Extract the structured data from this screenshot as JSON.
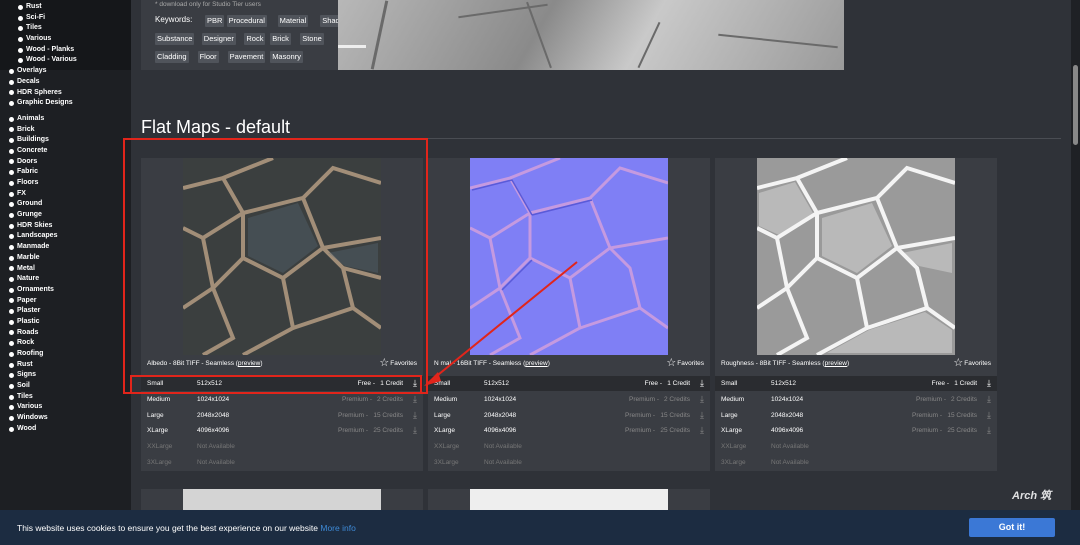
{
  "sidebar": {
    "sub_items": [
      "Rust",
      "Sci-Fi",
      "Tiles",
      "Various",
      "Wood - Planks",
      "Wood - Various"
    ],
    "group1": [
      "Overlays",
      "Decals",
      "HDR Spheres",
      "Graphic Designs"
    ],
    "group2": [
      "Animals",
      "Brick",
      "Buildings",
      "Concrete",
      "Doors",
      "Fabric",
      "Floors",
      "FX",
      "Ground",
      "Grunge",
      "HDR Skies",
      "Landscapes",
      "Manmade",
      "Marble",
      "Metal",
      "Nature",
      "Ornaments",
      "Paper",
      "Plaster",
      "Plastic",
      "Roads",
      "Rock",
      "Roofing",
      "Rust",
      "Signs",
      "Soil",
      "Tiles",
      "Various",
      "Windows",
      "Wood"
    ]
  },
  "info": {
    "note": "* download only for Studio Tier users",
    "keywords_label": "Keywords:",
    "tags": [
      "PBR",
      "Procedural",
      "Material",
      "Shader",
      "Substance",
      "Designer",
      "Rock",
      "Brick",
      "Stone",
      "Cladding",
      "Floor",
      "Pavement",
      "Masonry"
    ]
  },
  "section": {
    "title": "Flat Maps - default"
  },
  "cards": [
    {
      "format": "Albedo - 8Bit TIFF - Seamless",
      "preview": "preview",
      "favorites": "Favorites",
      "rows": [
        {
          "name": "Small",
          "size": "512x512",
          "price": "Free -",
          "credit": "1 Credit"
        },
        {
          "name": "Medium",
          "size": "1024x1024",
          "price": "Premium -",
          "credit": "2 Credits"
        },
        {
          "name": "Large",
          "size": "2048x2048",
          "price": "Premium -",
          "credit": "15 Credits"
        },
        {
          "name": "XLarge",
          "size": "4096x4096",
          "price": "Premium -",
          "credit": "25 Credits"
        },
        {
          "name": "XXLarge",
          "size": "Not Available",
          "price": "",
          "credit": ""
        },
        {
          "name": "3XLarge",
          "size": "Not Available",
          "price": "",
          "credit": ""
        }
      ]
    },
    {
      "format": "Normal - 16Bit TIFF - Seamless",
      "format_visible": "N  mal - 16Bit TIFF - Seamless",
      "preview": "preview",
      "favorites": "Favorites",
      "rows": [
        {
          "name": "Small",
          "size": "512x512",
          "price": "Free -",
          "credit": "1 Credit"
        },
        {
          "name": "Medium",
          "size": "1024x1024",
          "price": "Premium -",
          "credit": "2 Credits"
        },
        {
          "name": "Large",
          "size": "2048x2048",
          "price": "Premium -",
          "credit": "15 Credits"
        },
        {
          "name": "XLarge",
          "size": "4096x4096",
          "price": "Premium -",
          "credit": "25 Credits"
        },
        {
          "name": "XXLarge",
          "size": "Not Available",
          "price": "",
          "credit": ""
        },
        {
          "name": "3XLarge",
          "size": "Not Available",
          "price": "",
          "credit": ""
        }
      ]
    },
    {
      "format": "Roughness - 8Bit TIFF - Seamless",
      "preview": "preview",
      "favorites": "Favorites",
      "rows": [
        {
          "name": "Small",
          "size": "512x512",
          "price": "Free -",
          "credit": "1 Credit"
        },
        {
          "name": "Medium",
          "size": "1024x1024",
          "price": "Premium -",
          "credit": "2 Credits"
        },
        {
          "name": "Large",
          "size": "2048x2048",
          "price": "Premium -",
          "credit": "15 Credits"
        },
        {
          "name": "XLarge",
          "size": "4096x4096",
          "price": "Premium -",
          "credit": "25 Credits"
        },
        {
          "name": "XXLarge",
          "size": "Not Available",
          "price": "",
          "credit": ""
        },
        {
          "name": "3XLarge",
          "size": "Not Available",
          "price": "",
          "credit": ""
        }
      ]
    }
  ],
  "cookie": {
    "text": "This website uses cookies to ensure you get the best experience on our website",
    "link": "More info",
    "button": "Got it!"
  },
  "watermark": {
    "text": "Arch 筑"
  },
  "colors": {
    "annotation": "#e1251b",
    "accent": "#3b78d6",
    "normal_map": "#7a7cf5"
  }
}
